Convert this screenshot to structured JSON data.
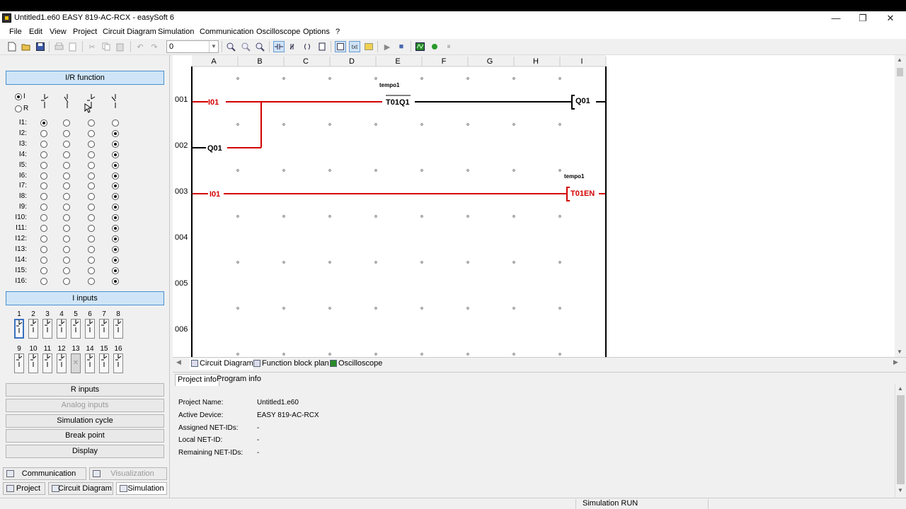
{
  "window": {
    "title": "Untitled1.e60 EASY 819-AC-RCX - easySoft 6",
    "minimize": "—",
    "maximize": "❐",
    "close": "✕"
  },
  "menu": [
    "File",
    "Edit",
    "View",
    "Project",
    "Circuit Diagram",
    "Simulation",
    "Communication",
    "Oscilloscope",
    "Options",
    "?"
  ],
  "toolbar": {
    "zoom_value": "0"
  },
  "left_panel": {
    "ir_function_header": "I/R function",
    "mode_i": "I",
    "mode_r": "R",
    "mode_selected": "I",
    "rows": [
      {
        "label": "I1:",
        "selected": 0
      },
      {
        "label": "I2:",
        "selected": 3
      },
      {
        "label": "I3:",
        "selected": 3
      },
      {
        "label": "I4:",
        "selected": 3
      },
      {
        "label": "I5:",
        "selected": 3
      },
      {
        "label": "I6:",
        "selected": 3
      },
      {
        "label": "I7:",
        "selected": 3
      },
      {
        "label": "I8:",
        "selected": 3
      },
      {
        "label": "I9:",
        "selected": 3
      },
      {
        "label": "I10:",
        "selected": 3
      },
      {
        "label": "I11:",
        "selected": 3
      },
      {
        "label": "I12:",
        "selected": 3
      },
      {
        "label": "I13:",
        "selected": 3
      },
      {
        "label": "I14:",
        "selected": 3
      },
      {
        "label": "I15:",
        "selected": 3
      },
      {
        "label": "I16:",
        "selected": 3
      }
    ],
    "i_inputs_header": "I inputs",
    "inputs_row1": [
      "1",
      "2",
      "3",
      "4",
      "5",
      "6",
      "7",
      "8"
    ],
    "inputs_row2": [
      "9",
      "10",
      "11",
      "12",
      "13",
      "14",
      "15",
      "16"
    ],
    "buttons": {
      "r_inputs": "R inputs",
      "analog_inputs": "Analog inputs",
      "simulation_cycle": "Simulation cycle",
      "break_point": "Break point",
      "display": "Display"
    },
    "tabs": {
      "communication": "Communication",
      "visualization": "Visualization",
      "project": "Project",
      "circuit_diagram": "Circuit Diagram",
      "simulation": "Simulation"
    }
  },
  "diagram": {
    "columns": [
      "A",
      "B",
      "C",
      "D",
      "E",
      "F",
      "G",
      "H",
      "I"
    ],
    "rows": [
      "001",
      "002",
      "003",
      "004",
      "005",
      "006"
    ],
    "elements": {
      "r1_contact": "I01",
      "r1_timer_label": "tempo1",
      "r1_timer_contact": "T01Q1",
      "r1_coil": "Q01",
      "r2_contact": "Q01",
      "r3_contact": "I01",
      "r3_timer_label": "tempo1",
      "r3_coil": "T01EN"
    },
    "energized_color": "#d40000",
    "wire_color": "#000000"
  },
  "diagram_tabs": [
    "Circuit Diagram",
    "Function block plan",
    "Oscilloscope"
  ],
  "info_panel": {
    "tabs": [
      "Project info",
      "Program info"
    ],
    "fields": [
      {
        "key": "Project Name:",
        "value": "Untitled1.e60"
      },
      {
        "key": "Active Device:",
        "value": "EASY 819-AC-RCX"
      },
      {
        "key": "Assigned NET-IDs:",
        "value": "-"
      },
      {
        "key": "Local NET-ID:",
        "value": "-"
      },
      {
        "key": "Remaining NET-IDs:",
        "value": "-"
      }
    ]
  },
  "status": {
    "text": "Simulation RUN"
  }
}
